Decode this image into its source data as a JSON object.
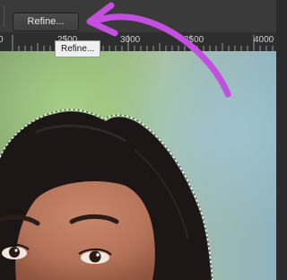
{
  "options_bar": {
    "refine_button_label": "Refine..."
  },
  "tooltip": {
    "text": "Refine..."
  },
  "ruler": {
    "labels": [
      "0",
      "2500",
      "3000",
      "3500",
      "4000"
    ]
  },
  "annotation": {
    "arrow_color": "#c34fe0"
  },
  "canvas": {
    "subject": "portrait-photo",
    "selection": "marching-ants-outline"
  }
}
